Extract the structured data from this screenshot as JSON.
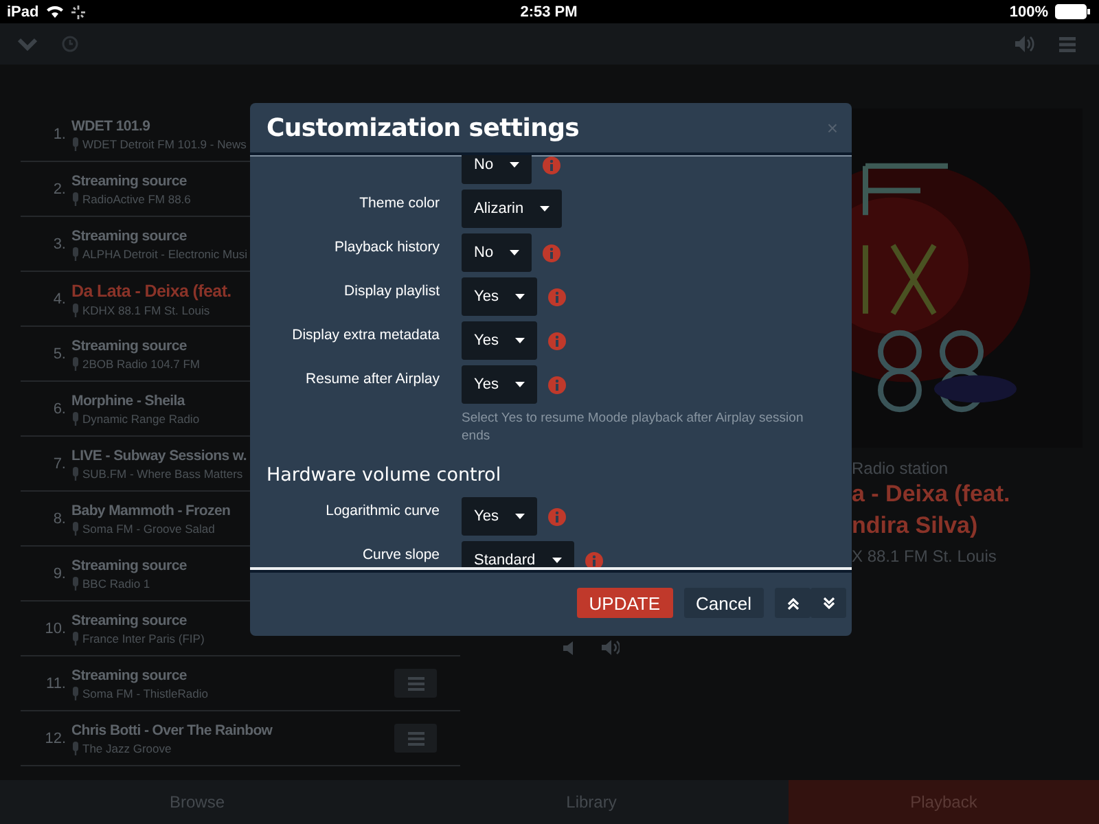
{
  "status_bar": {
    "device": "iPad",
    "time": "2:53 PM",
    "battery": "100%"
  },
  "playlist": [
    {
      "number": "1.",
      "title": "WDET 101.9",
      "station": "WDET Detroit FM 101.9 - News",
      "current": false,
      "menu_button": false
    },
    {
      "number": "2.",
      "title": "Streaming source",
      "station": "RadioActive FM 88.6",
      "current": false,
      "menu_button": false
    },
    {
      "number": "3.",
      "title": "Streaming source",
      "station": "ALPHA Detroit - Electronic Musi",
      "current": false,
      "menu_button": false
    },
    {
      "number": "4.",
      "title": "Da Lata - Deixa (feat.",
      "station": "KDHX 88.1 FM St. Louis",
      "current": true,
      "menu_button": false
    },
    {
      "number": "5.",
      "title": "Streaming source",
      "station": "2BOB Radio 104.7 FM",
      "current": false,
      "menu_button": false
    },
    {
      "number": "6.",
      "title": "Morphine - Sheila",
      "station": "Dynamic Range Radio",
      "current": false,
      "menu_button": false
    },
    {
      "number": "7.",
      "title": "LIVE - Subway Sessions w.",
      "station": "SUB.FM - Where Bass Matters",
      "current": false,
      "menu_button": false
    },
    {
      "number": "8.",
      "title": "Baby Mammoth - Frozen",
      "station": "Soma FM - Groove Salad",
      "current": false,
      "menu_button": false
    },
    {
      "number": "9.",
      "title": "Streaming source",
      "station": "BBC Radio 1",
      "current": false,
      "menu_button": false
    },
    {
      "number": "10.",
      "title": "Streaming source",
      "station": "France Inter Paris (FIP)",
      "current": false,
      "menu_button": false
    },
    {
      "number": "11.",
      "title": "Streaming source",
      "station": "Soma FM - ThistleRadio",
      "current": false,
      "menu_button": true
    },
    {
      "number": "12.",
      "title": "Chris Botti - Over The Rainbow",
      "station": "The Jazz Groove",
      "current": false,
      "menu_button": true
    }
  ],
  "now_playing": {
    "type": "Radio station",
    "title_lines": [
      "a - Deixa (feat.",
      "ndira Silva)"
    ],
    "station": "X 88.1 FM St. Louis"
  },
  "settings_dialog": {
    "title": "Customization settings",
    "close": "×",
    "rows": [
      {
        "kind": "select",
        "value": "No",
        "info": true
      },
      {
        "kind": "select",
        "label": "Theme color",
        "value": "Alizarin",
        "info": false
      },
      {
        "kind": "select",
        "label": "Playback history",
        "value": "No",
        "info": true
      },
      {
        "kind": "select",
        "label": "Display playlist",
        "value": "Yes",
        "info": true
      },
      {
        "kind": "select",
        "label": "Display extra metadata",
        "value": "Yes",
        "info": true
      },
      {
        "kind": "select",
        "label": "Resume after Airplay",
        "value": "Yes",
        "info": true
      },
      {
        "kind": "help",
        "text": "Select Yes to resume Moode playback after Airplay session ends"
      },
      {
        "kind": "heading",
        "text": "Hardware volume control"
      },
      {
        "kind": "select",
        "label": "Logarithmic curve",
        "value": "Yes",
        "info": true
      },
      {
        "kind": "select",
        "label": "Curve slope",
        "value": "Standard",
        "info": true
      }
    ],
    "buttons": [
      {
        "kind": "primary",
        "label": "UPDATE"
      },
      {
        "kind": "secondary",
        "label": "Cancel"
      },
      {
        "kind": "scroll_up"
      },
      {
        "kind": "scroll_down"
      }
    ]
  },
  "tabs": [
    {
      "label": "Browse",
      "selected": false
    },
    {
      "label": "Library",
      "selected": false
    },
    {
      "label": "Playback",
      "selected": true
    }
  ]
}
